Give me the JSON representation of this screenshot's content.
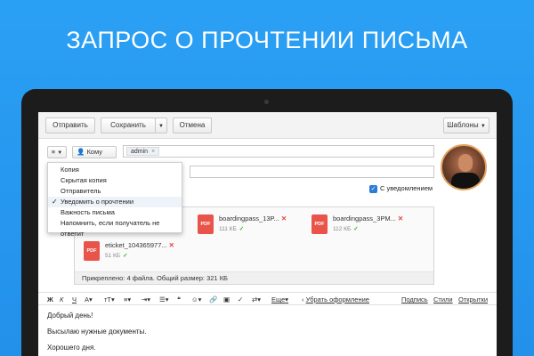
{
  "headline": "ЗАПРОС О ПРОЧТЕНИИ ПИСЬМА",
  "toolbar": {
    "send_label": "Отправить",
    "save_label": "Сохранить",
    "cancel_label": "Отмена",
    "templates_label": "Шаблоны"
  },
  "recipient": {
    "to_label": "Кому",
    "chip": "admin"
  },
  "menu": {
    "items": [
      {
        "label": "Копия",
        "checked": false
      },
      {
        "label": "Скрытая копия",
        "checked": false
      },
      {
        "label": "Отправитель",
        "checked": false
      },
      {
        "label": "Уведомить о прочтении",
        "checked": true
      },
      {
        "label": "Важность письма",
        "checked": false
      },
      {
        "label": "Напомнить, если получатель не ответит",
        "checked": false
      }
    ]
  },
  "notify_label": "С уведомлением",
  "attachments": {
    "files": [
      {
        "name": "boardingpass_13P...",
        "size": "111 КБ"
      },
      {
        "name": "boardingpass_3PM...",
        "size": "112 КБ"
      },
      {
        "name": "eticket_104365977...",
        "size": "51 КБ"
      }
    ],
    "pdf_label": "PDF",
    "summary": "Прикреплено: 4 файла. Общий размер: 321 КБ"
  },
  "format": {
    "bold": "Ж",
    "italic": "К",
    "underline": "Ч",
    "more_label": "Еще",
    "remove_format": "Убрать оформление",
    "signature": "Подпись",
    "styles": "Стили",
    "postcards": "Открытки"
  },
  "body": {
    "line1": "Добрый день!",
    "line2": "Высылаю нужные документы.",
    "line3": "Хорошего дня."
  },
  "colors": {
    "background": "#2390ea",
    "pdf": "#e8544a",
    "accent": "#2b7bd8"
  }
}
